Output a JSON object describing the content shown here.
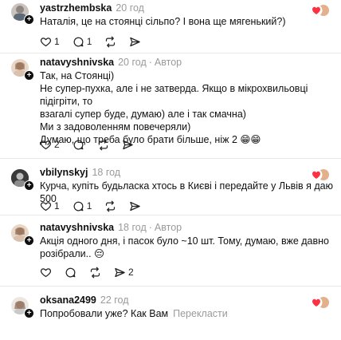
{
  "comments": [
    {
      "user": "yastrzhembska",
      "time": "20 год",
      "author_label": "",
      "lines": [
        "Наталія, це на стоянці сільпо? І вона ще мягенький?)"
      ],
      "likes": "1",
      "replies": "1",
      "reposts": "",
      "shares": ""
    },
    {
      "user": "natavyshnivska",
      "time": "20 год",
      "author_label": "Автор",
      "lines": [
        "Так, на Стоянці)",
        "Не супер-пухка, але і не затверда. Якщо в мікрохвильовці підігріти, то",
        "взагалі супер буде, думаю) але і так смачна)",
        "Ми з задоволенням повечеряли)",
        "Думаю, що треба було брати більше, ніж 2 😁😁"
      ],
      "likes": "2",
      "replies": "",
      "reposts": "",
      "shares": ""
    },
    {
      "user": "vbilynskyj",
      "time": "18 год",
      "author_label": "",
      "lines": [
        "Курча, купіть будьласка хтось в Києві і передайте у Львів я даю 500"
      ],
      "likes": "1",
      "replies": "1",
      "reposts": "",
      "shares": ""
    },
    {
      "user": "natavyshnivska",
      "time": "18 год",
      "author_label": "Автор",
      "lines": [
        "Акція одного дня, і пасок було ~10 шт. Тому, думаю, вже давно",
        "розібрали.. 😔"
      ],
      "likes": "",
      "replies": "",
      "reposts": "",
      "shares": "2"
    },
    {
      "user": "oksana2499",
      "time": "22 год",
      "author_label": "",
      "lines": [
        "Попробовали уже? Как Вам"
      ],
      "translate": "Перекласти",
      "likes": "",
      "replies": "",
      "reposts": "",
      "shares": ""
    }
  ],
  "icons": {
    "like": "heart-icon",
    "reply": "comment-bubble-icon",
    "repost": "repost-arrows-icon",
    "share": "send-arrow-icon",
    "reaction": "heart-reaction-badge-icon"
  },
  "colors": {
    "text": "#101010",
    "muted": "#9a9a9a",
    "separator": "#e8e8e8",
    "reaction_red": "#ff3040"
  }
}
